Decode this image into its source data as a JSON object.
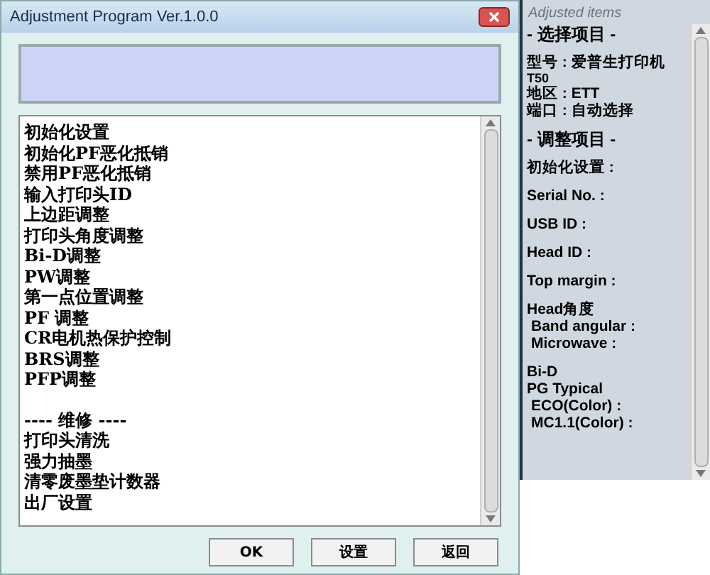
{
  "window": {
    "title": "Adjustment Program Ver.1.0.0"
  },
  "list": {
    "items": [
      "初始化设置",
      "初始化PF恶化抵销",
      "禁用PF恶化抵销",
      "输入打印头ID",
      "上边距调整",
      "打印头角度调整",
      "Bi-D调整",
      "PW调整",
      "第一点位置调整",
      "PF 调整",
      "CR电机热保护控制",
      "BRS调整",
      "PFP调整"
    ],
    "maintenance_header": "---- 维修 ----",
    "maintenance_items": [
      "打印头清洗",
      "强力抽墨",
      "清零废墨垫计数器",
      "出厂设置"
    ]
  },
  "buttons": [
    "OK",
    "设置",
    "返回"
  ],
  "side_panel": {
    "title": "Adjusted items",
    "groups": [
      [
        {
          "text": "- 选择项目 -",
          "kind": "heading"
        }
      ],
      [
        {
          "text": "型号 : 爱普生打印机",
          "kind": "line"
        },
        {
          "text": "T50",
          "kind": "small"
        },
        {
          "text": "地区 : ETT",
          "kind": "line"
        },
        {
          "text": "端口 : 自动选择",
          "kind": "line"
        }
      ],
      [
        {
          "text": "- 调整项目 -",
          "kind": "heading"
        }
      ],
      [
        {
          "text": "初始化设置 :",
          "kind": "line"
        }
      ],
      [
        {
          "text": "Serial No. :",
          "kind": "line"
        }
      ],
      [
        {
          "text": "USB ID :",
          "kind": "line"
        }
      ],
      [
        {
          "text": "Head ID :",
          "kind": "line"
        }
      ],
      [
        {
          "text": "Top margin :",
          "kind": "line"
        }
      ],
      [
        {
          "text": "Head角度",
          "kind": "line"
        },
        {
          "text": "Band angular :",
          "kind": "sub"
        },
        {
          "text": "Microwave :",
          "kind": "sub"
        }
      ],
      [
        {
          "text": "Bi-D",
          "kind": "line"
        },
        {
          "text": "PG Typical",
          "kind": "line"
        },
        {
          "text": "ECO(Color) :",
          "kind": "sub"
        },
        {
          "text": "MC1.1(Color) :",
          "kind": "sub"
        }
      ]
    ]
  }
}
